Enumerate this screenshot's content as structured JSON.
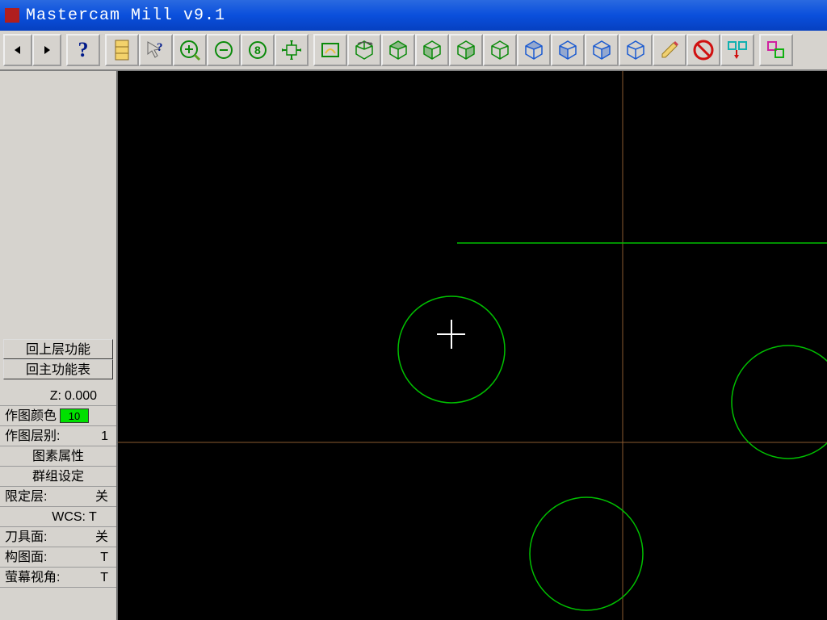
{
  "title": "Mastercam Mill v9.1",
  "toolbar": {
    "back": "◄",
    "forward": "►",
    "help": "?"
  },
  "sidebar": {
    "back_menu": "回上层功能",
    "main_menu": "回主功能表",
    "z_label": "Z:",
    "z_value": "0.000",
    "color_label": "作图颜色",
    "color_value": "10",
    "level_label": "作图层别:",
    "level_value": "1",
    "attributes": "图素属性",
    "group_set": "群组设定",
    "limit_layer_label": "限定层:",
    "limit_layer_value": "关",
    "wcs_label": "WCS:",
    "wcs_value": "T",
    "tool_plane_label": "刀具面:",
    "tool_plane_value": "关",
    "cplane_label": "构图面:",
    "cplane_value": "T",
    "gview_label": "萤幕视角:",
    "gview_value": "T"
  },
  "colors": {
    "geom_green": "#00c000",
    "axis_brown": "#8a5a30",
    "crosshair": "#ffffff",
    "swatch": "#00e000"
  }
}
